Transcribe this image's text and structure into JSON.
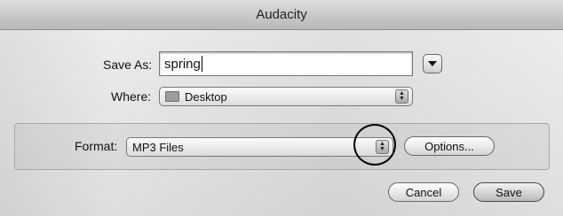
{
  "window": {
    "title": "Audacity"
  },
  "save_as": {
    "label": "Save As:",
    "value": "spring"
  },
  "where": {
    "label": "Where:",
    "value": "Desktop"
  },
  "format": {
    "label": "Format:",
    "value": "MP3 Files"
  },
  "buttons": {
    "options": "Options...",
    "cancel": "Cancel",
    "save": "Save"
  },
  "icons": {
    "disclosure": "chevron-down-icon",
    "folder": "folder-icon",
    "popup_arrows": "up-down-arrows-icon"
  }
}
